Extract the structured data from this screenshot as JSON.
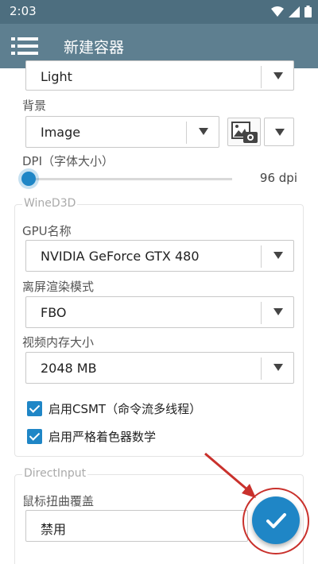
{
  "status_bar": {
    "time": "2:03"
  },
  "app_bar": {
    "title": "新建容器"
  },
  "theme": {
    "selected": "Light"
  },
  "background": {
    "label": "背景",
    "selected": "Image"
  },
  "dpi": {
    "label": "DPI（字体大小）",
    "value_text": "96 dpi",
    "level": 0.0
  },
  "wined3d": {
    "title": "WineD3D",
    "gpu_label": "GPU名称",
    "gpu_selected": "NVIDIA GeForce GTX 480",
    "offscreen_label": "离屏渲染模式",
    "offscreen_selected": "FBO",
    "vram_label": "视频内存大小",
    "vram_selected": "2048 MB",
    "csmt_label": "启用CSMT（命令流多线程）",
    "csmt_checked": true,
    "strict_label": "启用严格着色器数学",
    "strict_checked": true
  },
  "directinput": {
    "title": "DirectInput",
    "mouse_label": "鼠标扭曲覆盖",
    "mouse_selected": "禁用"
  },
  "colors": {
    "app_bar": "#5e7f90",
    "status_bar": "#4d6e7f",
    "accent": "#1f86c6",
    "annotation": "#c9312c"
  }
}
